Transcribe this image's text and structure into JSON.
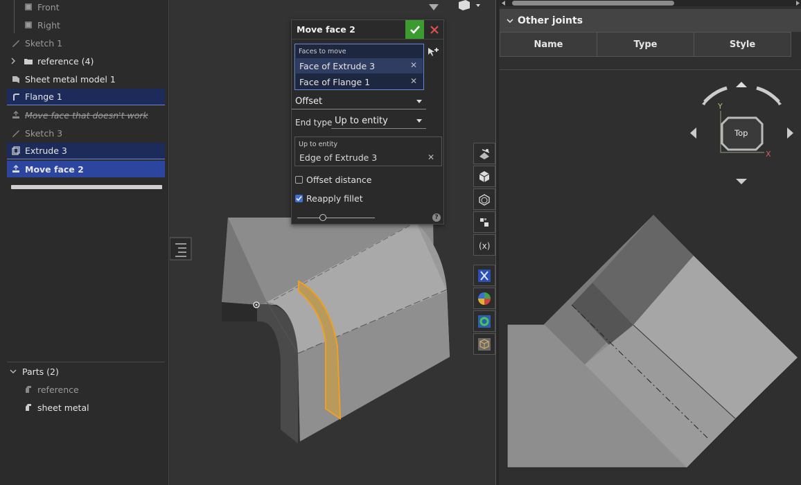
{
  "feature_tree": {
    "items": [
      {
        "label": "Front",
        "icon": "plane-icon"
      },
      {
        "label": "Right",
        "icon": "plane-icon"
      },
      {
        "label": "Sketch 1",
        "icon": "sketch-icon"
      },
      {
        "label": "reference (4)",
        "icon": "folder-icon"
      },
      {
        "label": "Sheet metal model 1",
        "icon": "sheet-metal-icon"
      },
      {
        "label": "Flange 1",
        "icon": "flange-icon"
      },
      {
        "label": "Move face that doesn't work",
        "icon": "move-face-icon"
      },
      {
        "label": "Sketch 3",
        "icon": "sketch-icon"
      },
      {
        "label": "Extrude 3",
        "icon": "extrude-icon"
      },
      {
        "label": "Move face 2",
        "icon": "move-face-icon"
      }
    ]
  },
  "parts": {
    "header": "Parts (2)",
    "items": [
      {
        "label": "reference"
      },
      {
        "label": "sheet metal"
      }
    ]
  },
  "dialog": {
    "title": "Move face 2",
    "faces_label": "Faces to move",
    "faces": [
      "Face of Extrude 3",
      "Face of Flange 1"
    ],
    "mode": "Offset",
    "end_type_label": "End type",
    "end_type": "Up to entity",
    "up_to_entity_label": "Up to entity",
    "up_to_entity": "Edge of Extrude 3",
    "offset_distance_label": "Offset distance",
    "offset_distance_checked": false,
    "reapply_fillet_label": "Reapply fillet",
    "reapply_fillet_checked": true,
    "help": "?"
  },
  "right_panel": {
    "section_title": "Other joints",
    "columns": [
      "Name",
      "Type",
      "Style"
    ]
  },
  "view_cube": {
    "face": "Top",
    "axis_y": "Y",
    "axis_x": "X"
  },
  "colors": {
    "selection_dark": "#1c2b5a",
    "selection_bright": "#2c46a0",
    "accept_green": "#3c9b2e",
    "cancel_red": "#e05050",
    "highlight_orange": "#f0a020"
  }
}
